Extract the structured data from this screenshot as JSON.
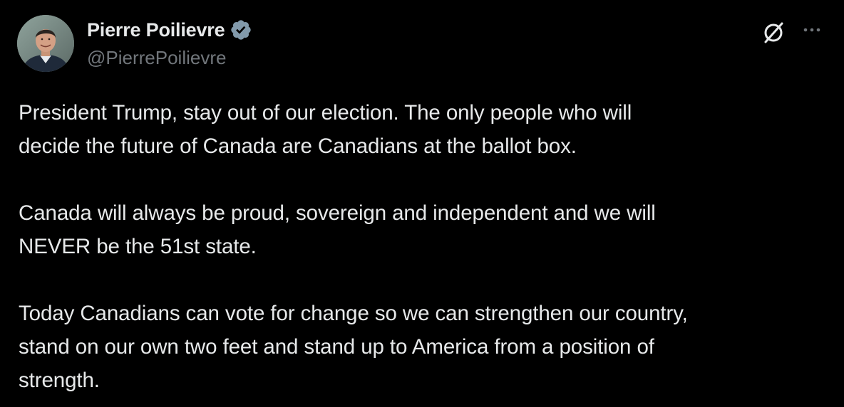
{
  "post": {
    "author": {
      "display_name": "Pierre Poilievre",
      "handle": "@PierrePoilievre",
      "verified_icon": "verified-badge-icon",
      "avatar_icon": "avatar"
    },
    "actions": {
      "grok_icon": "grok-icon",
      "more_icon": "more-options-icon"
    },
    "body": {
      "paragraphs": [
        {
          "lines": [
            "President Trump, stay out of our election. The only people who will",
            "decide the future of Canada are Canadians at the ballot box."
          ]
        },
        {
          "lines": [
            "Canada will always be proud, sovereign and independent and we will",
            "NEVER be the 51st state."
          ]
        },
        {
          "lines": [
            "Today Canadians can vote for change so we can strengthen our country,",
            "stand on our own two feet and stand up to America from a position of",
            "strength."
          ]
        }
      ]
    }
  },
  "colors": {
    "background": "#000000",
    "primary_text": "#e7e9ea",
    "secondary_text": "#71767b",
    "verified_badge": "#829aab"
  }
}
